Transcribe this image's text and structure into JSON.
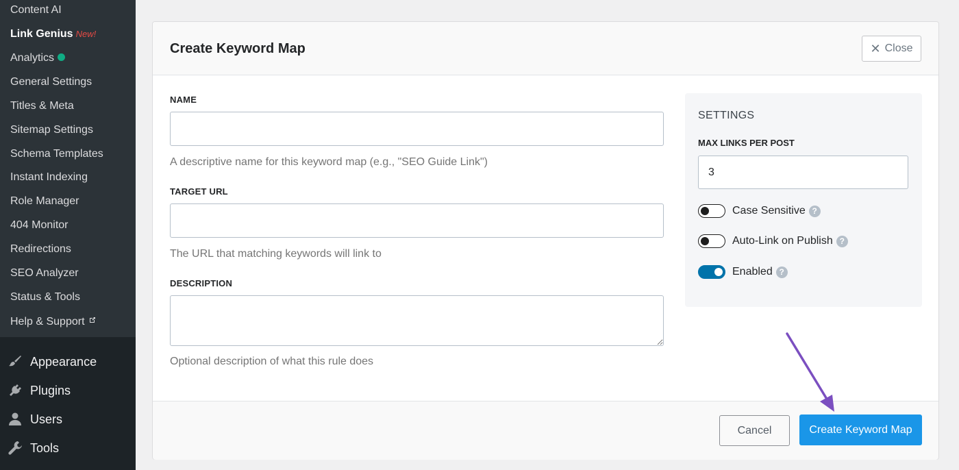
{
  "sidebar": {
    "submenu": [
      {
        "label": "Content AI"
      },
      {
        "label": "Link Genius",
        "badge": "New!",
        "active": true
      },
      {
        "label": "Analytics",
        "status_dot_color": "#10ac84"
      },
      {
        "label": "General Settings"
      },
      {
        "label": "Titles & Meta"
      },
      {
        "label": "Sitemap Settings"
      },
      {
        "label": "Schema Templates"
      },
      {
        "label": "Instant Indexing"
      },
      {
        "label": "Role Manager"
      },
      {
        "label": "404 Monitor"
      },
      {
        "label": "Redirections"
      },
      {
        "label": "SEO Analyzer"
      },
      {
        "label": "Status & Tools"
      },
      {
        "label": "Help & Support",
        "icon": "external-link-icon"
      }
    ],
    "menu": [
      {
        "label": "Appearance",
        "icon": "paintbrush-icon"
      },
      {
        "label": "Plugins",
        "icon": "plug-icon"
      },
      {
        "label": "Users",
        "icon": "user-icon"
      },
      {
        "label": "Tools",
        "icon": "wrench-icon"
      }
    ]
  },
  "modal": {
    "title": "Create Keyword Map",
    "close_label": "Close",
    "fields": {
      "name": {
        "label": "NAME",
        "value": "",
        "help": "A descriptive name for this keyword map (e.g., \"SEO Guide Link\")"
      },
      "target_url": {
        "label": "TARGET URL",
        "value": "",
        "help": "The URL that matching keywords will link to"
      },
      "description": {
        "label": "DESCRIPTION",
        "value": "",
        "help": "Optional description of what this rule does"
      }
    },
    "settings": {
      "title": "SETTINGS",
      "max_links_label": "MAX LINKS PER POST",
      "max_links_value": "3",
      "toggles": [
        {
          "label": "Case Sensitive",
          "on": false
        },
        {
          "label": "Auto-Link on Publish",
          "on": false
        },
        {
          "label": "Enabled",
          "on": true
        }
      ]
    },
    "footer": {
      "cancel_label": "Cancel",
      "create_label": "Create Keyword Map"
    }
  },
  "colors": {
    "accent": "#1a96e8",
    "toggle_on": "#0073aa",
    "annotation_arrow": "#7b4fc0",
    "badge_new": "#e64a45"
  }
}
